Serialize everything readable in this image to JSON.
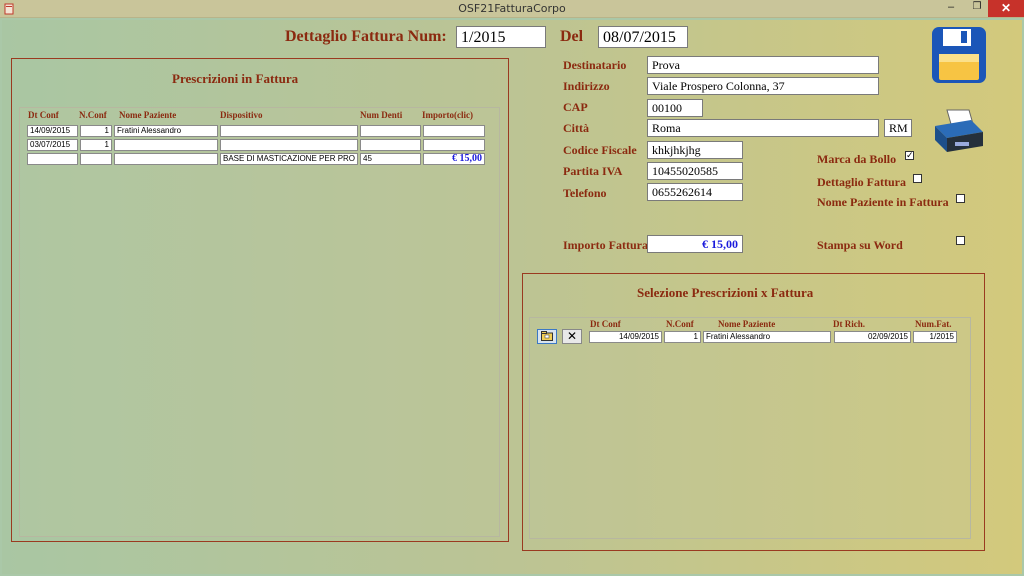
{
  "window": {
    "title": "OSF21FatturaCorpo",
    "minimize": "‒",
    "maximize": "❐",
    "close": "✕"
  },
  "header": {
    "num_label": "Dettaglio Fattura Num:",
    "num_value": "1/2015",
    "del_label": "Del",
    "del_value": "08/07/2015"
  },
  "prescrizioni": {
    "title": "Prescrizioni in Fattura",
    "columns": [
      "Dt Conf",
      "N.Conf",
      "Nome Paziente",
      "Dispositivo",
      "Num Denti",
      "Importo(clic)"
    ],
    "rows": [
      {
        "dt_conf": "14/09/2015",
        "n_conf": "1",
        "nome": "Fratini Alessandro",
        "dispositivo": "",
        "num_denti": "",
        "importo": ""
      },
      {
        "dt_conf": "03/07/2015",
        "n_conf": "1",
        "nome": "",
        "dispositivo": "",
        "num_denti": "",
        "importo": ""
      },
      {
        "dt_conf": "",
        "n_conf": "",
        "nome": "",
        "dispositivo": "BASE DI MASTICAZIONE PER PRO",
        "num_denti": "45",
        "importo": "€ 15,00"
      }
    ]
  },
  "dest": {
    "destinatario_label": "Destinatario",
    "destinatario": "Prova",
    "indirizzo_label": "Indirizzo",
    "indirizzo": "Viale Prospero Colonna, 37",
    "cap_label": "CAP",
    "cap": "00100",
    "citta_label": "Città",
    "citta": "Roma",
    "provincia": "RM",
    "cf_label": "Codice Fiscale",
    "cf": "khkjhkjhg",
    "piva_label": "Partita IVA",
    "piva": "10455020585",
    "tel_label": "Telefono",
    "tel": "0655262614",
    "importo_label": "Importo Fattura",
    "importo": "€ 15,00"
  },
  "options": {
    "marca_label": "Marca da Bollo",
    "marca_checked": "✓",
    "dettaglio_label": "Dettaglio Fattura",
    "nome_label": "Nome Paziente in Fattura",
    "word_label": "Stampa su Word"
  },
  "selezione": {
    "title": "Selezione Prescrizioni x Fattura",
    "columns": [
      "Dt Conf",
      "N.Conf",
      "Nome Paziente",
      "Dt Rich.",
      "Num.Fat."
    ],
    "rows": [
      {
        "dt_conf": "14/09/2015",
        "n_conf": "1",
        "nome": "Fratini Alessandro",
        "dt_rich": "02/09/2015",
        "num_fat": "1/2015"
      }
    ],
    "delete_glyph": "✕"
  },
  "icons": {
    "save": "save-disk-icon",
    "print": "printer-icon",
    "select": "folder-select-icon",
    "delete": "delete-x-icon"
  }
}
